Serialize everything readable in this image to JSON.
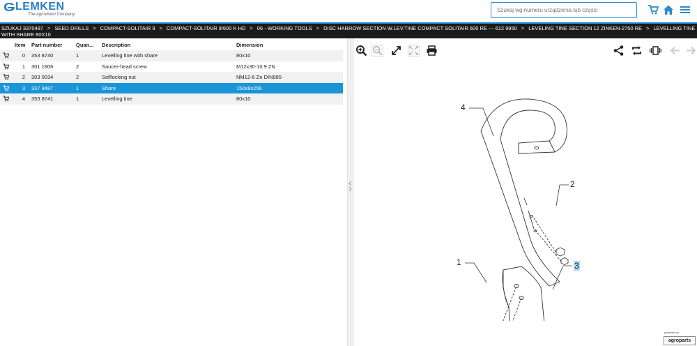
{
  "header": {
    "logo_text": "LEMKEN",
    "logo_sub": "The Agrovision Company",
    "search_placeholder": "Szukaj wg numeru urządzenia lub części",
    "brand_color": "#2a8cc9"
  },
  "breadcrumb": [
    "SZUKAJ 3370487",
    "SEED DRILLS",
    "COMPACT-SOLITAIR 9",
    "COMPACT-SOLITAIR 9/600 K HD",
    "06 - WORKING TOOLS",
    "DISC HARROW SECTION W.LEV.TINE COMPACT SOLITAIR 600 RE --- 612 9950",
    "LEVELING TINE SECTION 12 ZINKEN-2750 RE",
    "LEVELLING TINE WITH SHARE 80X10"
  ],
  "table": {
    "headers": {
      "item": "Item",
      "part": "Part number",
      "qty": "Quan...",
      "desc": "Description",
      "dim": "Dimension"
    },
    "rows": [
      {
        "item": "0",
        "part": "353 8740",
        "qty": "1",
        "desc": "Levelling tine with share",
        "dim": "80x10"
      },
      {
        "item": "1",
        "part": "301 1806",
        "qty": "2",
        "desc": "Saucer-head screw",
        "dim": "M12x30-10.9 ZN"
      },
      {
        "item": "2",
        "part": "303 0034",
        "qty": "2",
        "desc": "Selflocking nut",
        "dim": "NM12-6 Zn DIN985"
      },
      {
        "item": "3",
        "part": "337 9487",
        "qty": "1",
        "desc": "Share",
        "dim": "150x8x256"
      },
      {
        "item": "4",
        "part": "353 8741",
        "qty": "1",
        "desc": "Levelling tine",
        "dim": "80x10"
      }
    ],
    "selected_index": 3,
    "selected_color": "#1995d8"
  },
  "viewer": {
    "callouts": [
      "4",
      "2",
      "1",
      "3"
    ],
    "highlighted_callout": "3"
  },
  "footer": {
    "powered_by": "powered by",
    "brand": "agroparts"
  }
}
